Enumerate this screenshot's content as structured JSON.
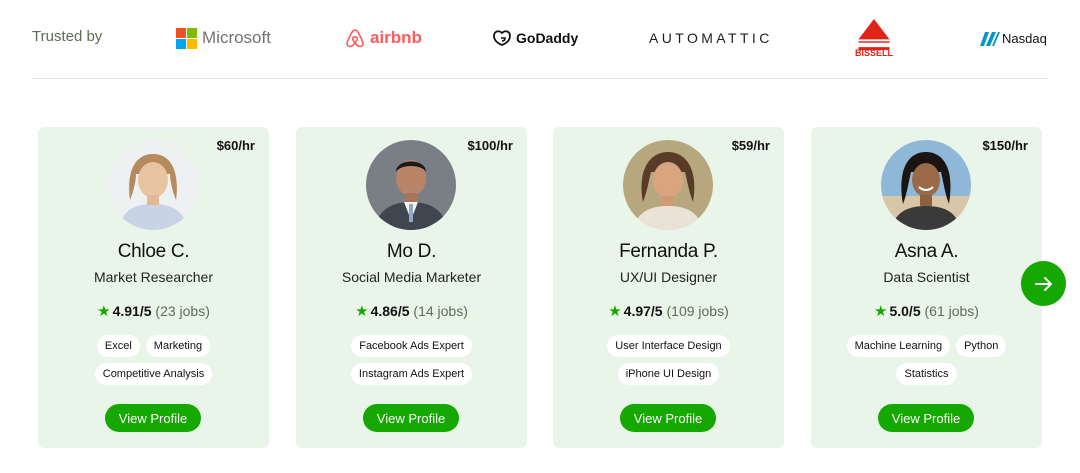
{
  "trusted_by": {
    "label": "Trusted by",
    "logos": [
      {
        "name": "Microsoft",
        "text": "Microsoft"
      },
      {
        "name": "airbnb",
        "text": "airbnb"
      },
      {
        "name": "GoDaddy",
        "text": "GoDaddy"
      },
      {
        "name": "Automattic",
        "text": "AUTOMATTIC"
      },
      {
        "name": "Bissell",
        "text": "BISSELL"
      },
      {
        "name": "Nasdaq",
        "text": "Nasdaq"
      }
    ]
  },
  "colors": {
    "brand_green": "#14a800",
    "card_background": "#eaf5e9",
    "muted_text": "#5e6d55"
  },
  "freelancers": [
    {
      "name": "Chloe C.",
      "title": "Market Researcher",
      "rate": "$60/hr",
      "score": "4.91/5",
      "jobs": "(23 jobs)",
      "tags": [
        "Excel",
        "Marketing",
        "Competitive Analysis"
      ],
      "button": "View Profile"
    },
    {
      "name": "Mo D.",
      "title": "Social Media Marketer",
      "rate": "$100/hr",
      "score": "4.86/5",
      "jobs": "(14 jobs)",
      "tags": [
        "Facebook Ads Expert",
        "Instagram Ads Expert"
      ],
      "button": "View Profile"
    },
    {
      "name": "Fernanda P.",
      "title": "UX/UI Designer",
      "rate": "$59/hr",
      "score": "4.97/5",
      "jobs": "(109 jobs)",
      "tags": [
        "User Interface Design",
        "iPhone UI Design"
      ],
      "button": "View Profile"
    },
    {
      "name": "Asna A.",
      "title": "Data Scientist",
      "rate": "$150/hr",
      "score": "5.0/5",
      "jobs": "(61 jobs)",
      "tags": [
        "Machine Learning",
        "Python",
        "Statistics"
      ],
      "button": "View Profile"
    }
  ],
  "carousel": {
    "next_icon": "arrow-right-icon"
  }
}
